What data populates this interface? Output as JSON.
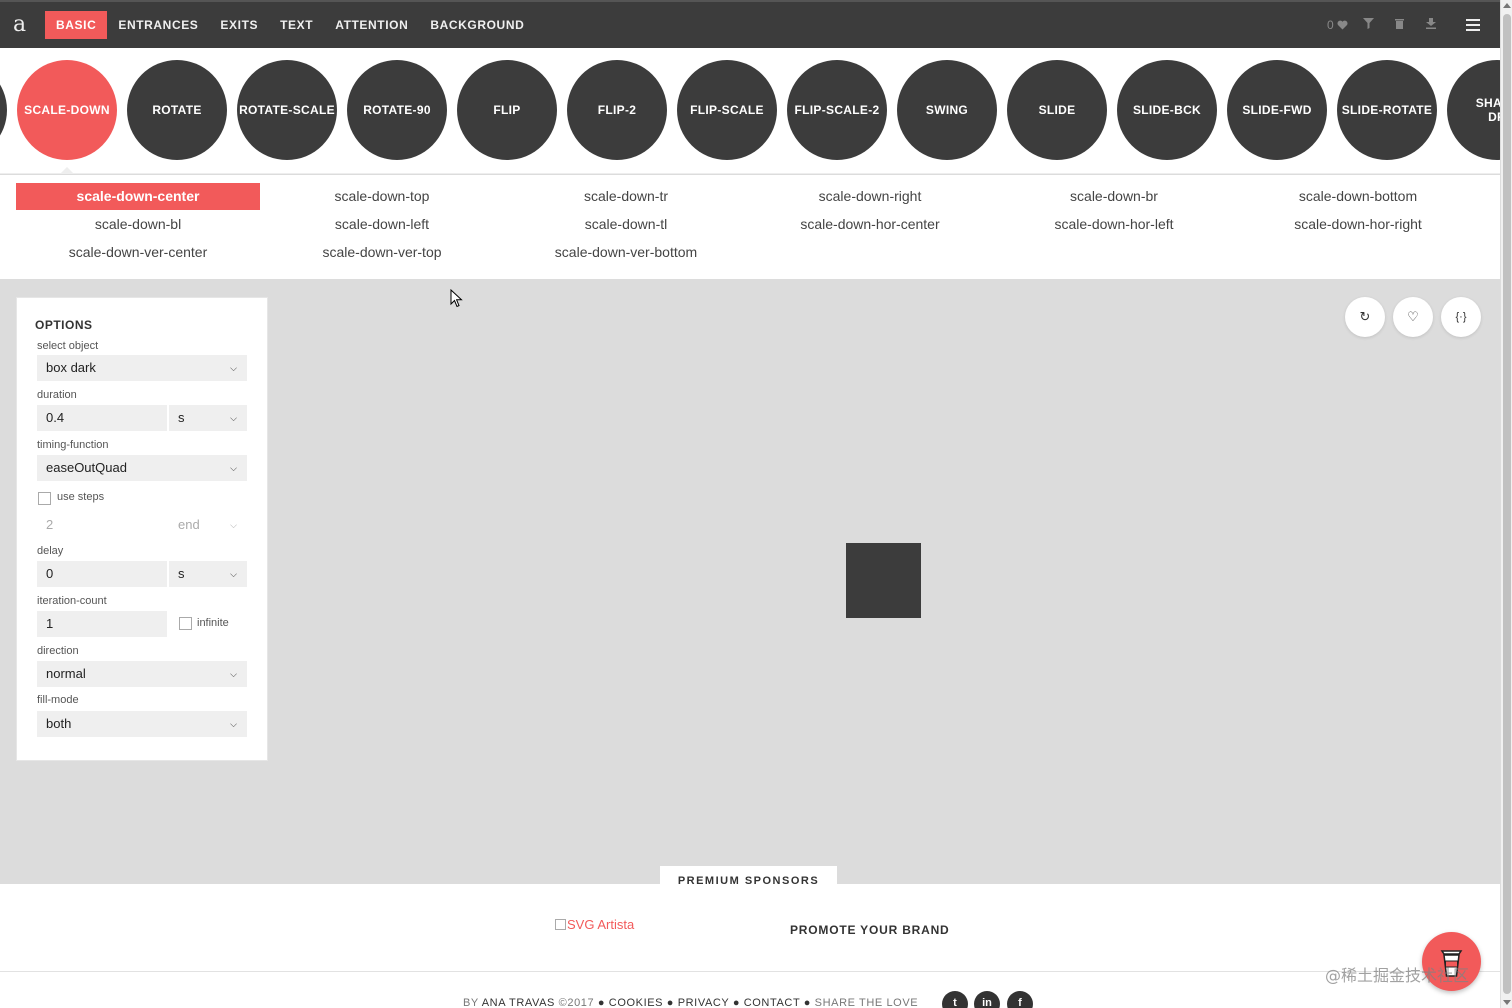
{
  "header": {
    "logo": "a",
    "nav": [
      "BASIC",
      "ENTRANCES",
      "EXITS",
      "TEXT",
      "ATTENTION",
      "BACKGROUND"
    ],
    "active_nav": "BASIC",
    "favorites_count": "0"
  },
  "circles": {
    "items": [
      "SCALE-DOWN",
      "ROTATE",
      "ROTATE-SCALE",
      "ROTATE-90",
      "FLIP",
      "FLIP-2",
      "FLIP-SCALE",
      "FLIP-SCALE-2",
      "SWING",
      "SLIDE",
      "SLIDE-BCK",
      "SLIDE-FWD",
      "SLIDE-ROTATE",
      "SHADOW-DROP"
    ],
    "active": "SCALE-DOWN"
  },
  "variants": {
    "items": [
      "scale-down-center",
      "scale-down-top",
      "scale-down-tr",
      "scale-down-right",
      "scale-down-br",
      "scale-down-bottom",
      "scale-down-bl",
      "scale-down-left",
      "scale-down-tl",
      "scale-down-hor-center",
      "scale-down-hor-left",
      "scale-down-hor-right",
      "scale-down-ver-center",
      "scale-down-ver-top",
      "scale-down-ver-bottom"
    ],
    "active": "scale-down-center"
  },
  "options": {
    "title": "OPTIONS",
    "select_object_label": "select object",
    "select_object_value": "box dark",
    "duration_label": "duration",
    "duration_value": "0.4",
    "duration_unit": "s",
    "timing_label": "timing-function",
    "timing_value": "easeOutQuad",
    "use_steps_label": "use steps",
    "steps_value": "2",
    "steps_position": "end",
    "delay_label": "delay",
    "delay_value": "0",
    "delay_unit": "s",
    "iteration_label": "iteration-count",
    "iteration_value": "1",
    "infinite_label": "infinite",
    "direction_label": "direction",
    "direction_value": "normal",
    "fill_label": "fill-mode",
    "fill_value": "both"
  },
  "actions": {
    "replay_icon": "↻",
    "favorite_icon": "♡",
    "code_icon": "{·}"
  },
  "sponsors": {
    "tab_label": "PREMIUM SPONSORS",
    "sponsor_alt": "SVG Artista",
    "promote": "PROMOTE YOUR BRAND"
  },
  "footer": {
    "by": "BY",
    "author": "ANA TRAVAS",
    "year": "©2017",
    "links": [
      "COOKIES",
      "PRIVACY",
      "CONTACT"
    ],
    "share": "SHARE THE LOVE",
    "social": [
      "t",
      "in",
      "f"
    ]
  },
  "watermark": "@稀土掘金技术社区",
  "colors": {
    "accent": "#f25a5a",
    "dark": "#3c3c3c",
    "stage": "#dcdcdc"
  }
}
